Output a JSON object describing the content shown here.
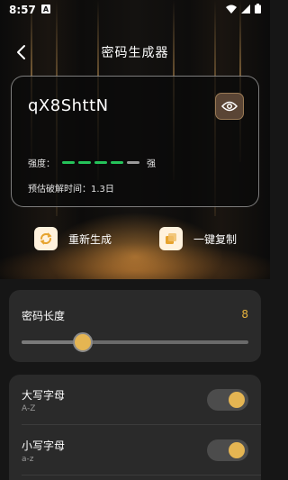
{
  "status": {
    "time": "8:57",
    "notification_icon": "a-notification-icon"
  },
  "header": {
    "title": "密码生成器"
  },
  "password": {
    "value": "qX8ShttN",
    "strength_label": "强度：",
    "strength_level_label": "强",
    "strength_segments": {
      "filled": 4,
      "total": 5,
      "color": "#25c35a"
    },
    "crack_time_label": "预估破解时间：",
    "crack_time_value": "1.3日"
  },
  "actions": {
    "regenerate_label": "重新生成",
    "copy_label": "一键复制"
  },
  "length": {
    "label": "密码长度",
    "value": "8",
    "slider_fraction": 0.27
  },
  "options": [
    {
      "name": "大写字母",
      "sub": "A-Z",
      "enabled": true
    },
    {
      "name": "小写字母",
      "sub": "a-z",
      "enabled": true
    }
  ],
  "colors": {
    "accent": "#e5b552",
    "strength_green": "#25c35a",
    "panel": "#2a2a2a"
  }
}
